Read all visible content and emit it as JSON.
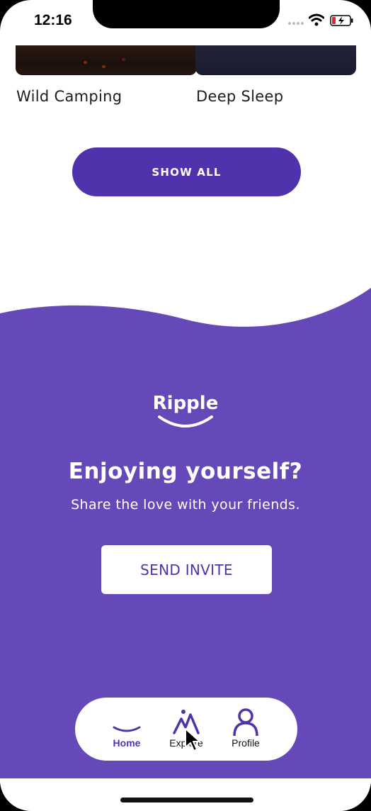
{
  "status_bar": {
    "time": "12:16"
  },
  "cards": [
    {
      "title": "Wild Camping"
    },
    {
      "title": "Deep Sleep"
    }
  ],
  "show_all_label": "SHOW ALL",
  "promo": {
    "logo_text": "Ripple",
    "headline": "Enjoying yourself?",
    "subline": "Share the love with your friends.",
    "button_label": "SEND INVITE"
  },
  "nav": {
    "items": [
      {
        "label": "Home",
        "icon": "home-smile-icon",
        "active": true
      },
      {
        "label": "Explore",
        "icon": "mountain-icon",
        "active": false
      },
      {
        "label": "Profile",
        "icon": "person-icon",
        "active": false
      }
    ]
  },
  "colors": {
    "brand_purple": "#6649b8",
    "button_purple": "#5132ad",
    "background": "#ffffff"
  }
}
